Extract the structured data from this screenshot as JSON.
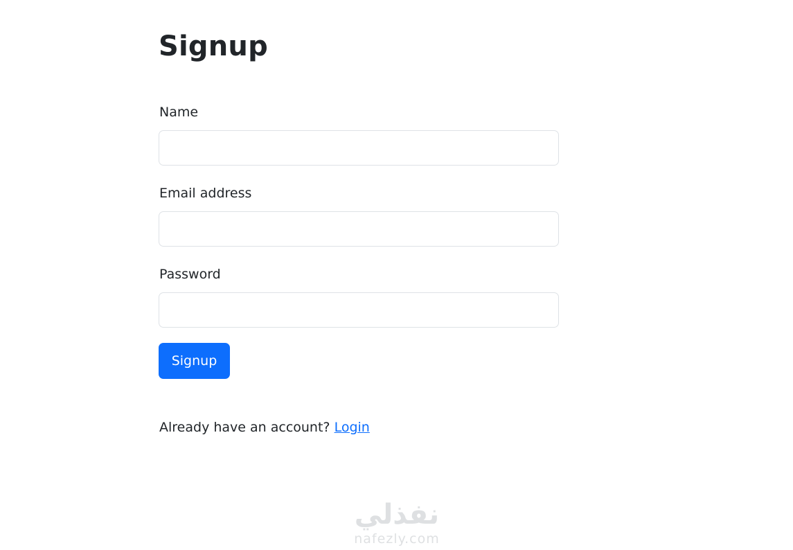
{
  "page": {
    "title": "Signup"
  },
  "form": {
    "name": {
      "label": "Name",
      "value": "",
      "placeholder": ""
    },
    "email": {
      "label": "Email address",
      "value": "",
      "placeholder": ""
    },
    "password": {
      "label": "Password",
      "value": "",
      "placeholder": ""
    },
    "submit_label": "Signup"
  },
  "footer": {
    "prompt_text": "Already have an account? ",
    "login_link_label": "Login"
  },
  "watermark": {
    "logo_text": "نفذلي",
    "url_text": "nafezly.com"
  },
  "colors": {
    "primary": "#0d6efd",
    "text": "#212529",
    "input_border": "#dee2e6",
    "background": "#ffffff"
  }
}
